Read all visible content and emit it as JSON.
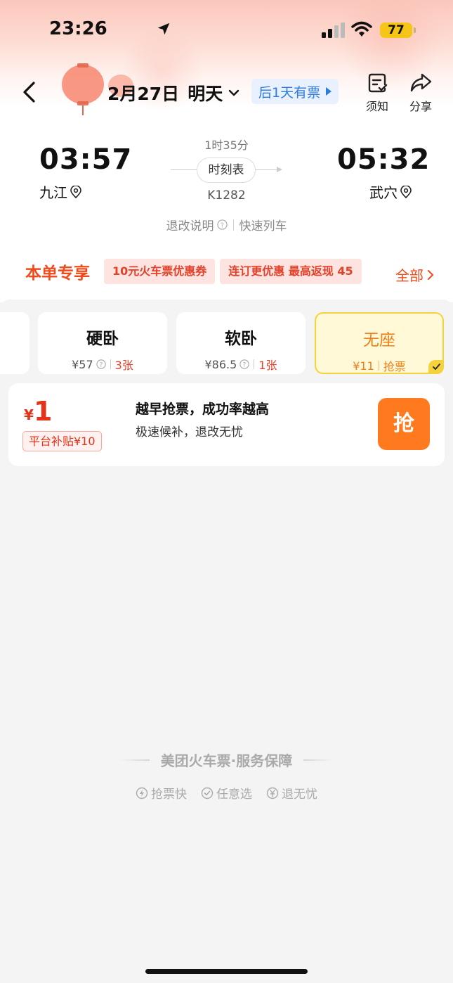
{
  "status_bar": {
    "time": "23:26",
    "battery": "77"
  },
  "header": {
    "date": "2月27日",
    "day": "明天",
    "ticket_tip": "后1天有票",
    "notice_label": "须知",
    "share_label": "分享"
  },
  "train": {
    "departure_time": "03:57",
    "departure_station": "九江",
    "arrival_time": "05:32",
    "arrival_station": "武穴",
    "duration": "1时35分",
    "schedule_label": "时刻表",
    "train_number": "K1282",
    "refund_label": "退改说明",
    "train_type": "快速列车"
  },
  "promo": {
    "title": "本单专享",
    "coupons": [
      "10元火车票优惠券",
      "连订更优惠 最高返现 45"
    ],
    "all_label": "全部"
  },
  "seats": [
    {
      "name": "硬卧",
      "price": "¥57",
      "status": "3张"
    },
    {
      "name": "软卧",
      "price": "¥86.5",
      "status": "1张"
    },
    {
      "name": "无座",
      "price": "¥11",
      "status": "抢票",
      "selected": true
    }
  ],
  "grab": {
    "currency": "¥",
    "price": "1",
    "subsidy": "平台补贴¥10",
    "title": "越早抢票，成功率越高",
    "subtitle": "极速候补，退改无忧",
    "button": "抢"
  },
  "footer": {
    "guarantee": "美团火车票·服务保障",
    "features": [
      "抢票快",
      "任意选",
      "退无忧"
    ]
  },
  "colors": {
    "accent": "#f04a1a",
    "grab_button": "#ff7a1f",
    "link": "#2b7be0",
    "selected_bg": "#fff9d8"
  }
}
